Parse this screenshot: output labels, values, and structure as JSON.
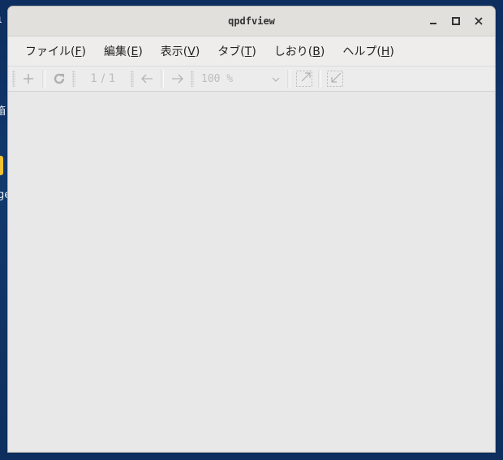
{
  "desktop": {
    "fragment_1": "ι",
    "fragment_2": "箱",
    "fragment_3": "ge"
  },
  "window": {
    "title": "qpdfview",
    "controls": {
      "minimize": "–",
      "maximize": "□",
      "close": "✕"
    }
  },
  "menubar": {
    "items": [
      {
        "label": "ファイル(",
        "acc": "F",
        "end": ")"
      },
      {
        "label": "編集(",
        "acc": "E",
        "end": ")"
      },
      {
        "label": "表示(",
        "acc": "V",
        "end": ")"
      },
      {
        "label": "タブ(",
        "acc": "T",
        "end": ")"
      },
      {
        "label": "しおり(",
        "acc": "B",
        "end": ")"
      },
      {
        "label": "ヘルプ(",
        "acc": "H",
        "end": ")"
      }
    ]
  },
  "toolbar": {
    "page_indicator": "1 / 1",
    "zoom_value": "100 %"
  }
}
